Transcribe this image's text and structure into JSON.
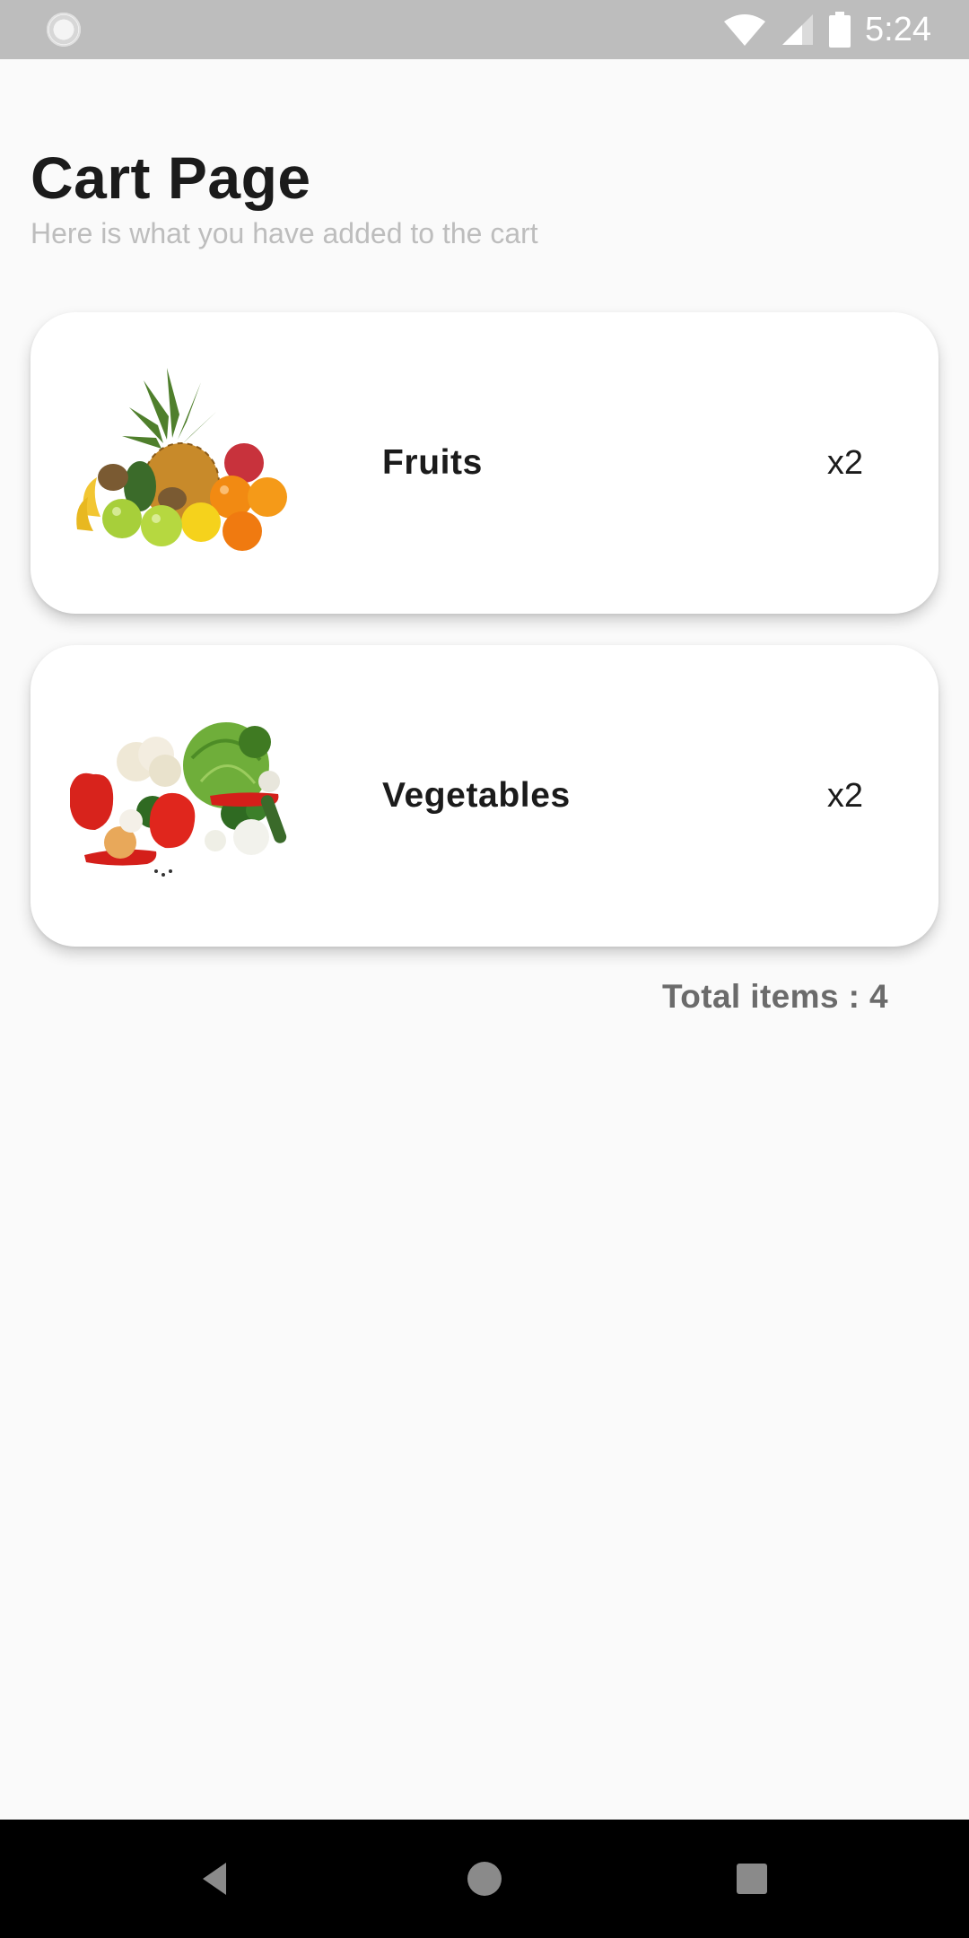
{
  "status_bar": {
    "time": "5:24",
    "icons": [
      "notification-icon",
      "wifi-icon",
      "signal-icon",
      "battery-icon"
    ]
  },
  "header": {
    "title": "Cart Page",
    "subtitle": "Here is what you have added to the cart"
  },
  "cart": {
    "items": [
      {
        "name": "Fruits",
        "quantity": "x2",
        "image": "fruits-image"
      },
      {
        "name": "Vegetables",
        "quantity": "x2",
        "image": "vegetables-image"
      }
    ],
    "total_label": "Total items : 4"
  },
  "nav_bar": {
    "buttons": [
      "back-icon",
      "home-icon",
      "recents-icon"
    ]
  }
}
